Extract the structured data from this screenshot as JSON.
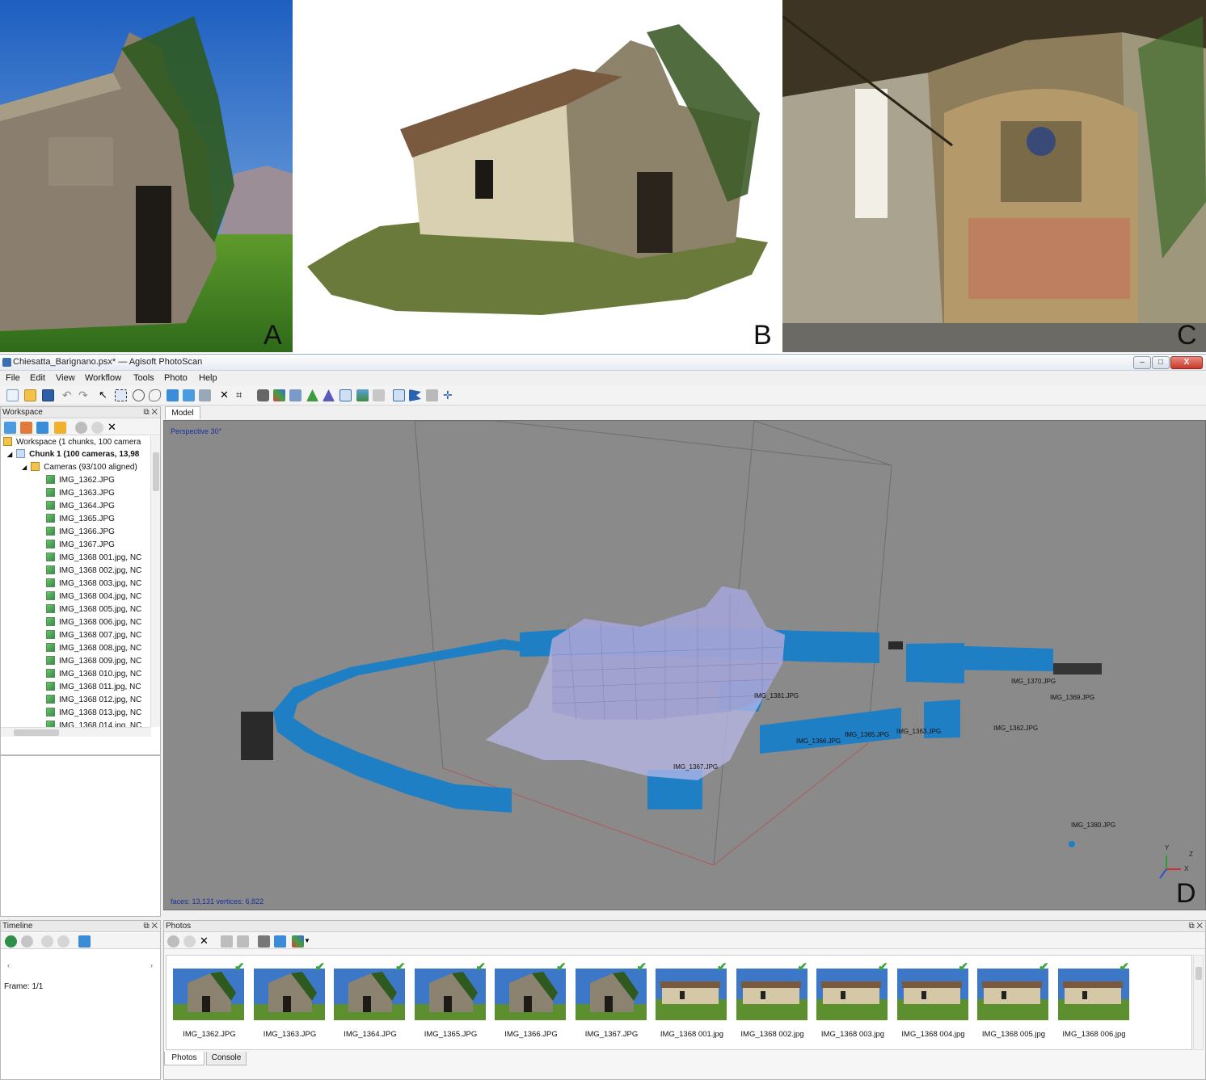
{
  "panels": {
    "a": {
      "letter": "A"
    },
    "b": {
      "letter": "B"
    },
    "c": {
      "letter": "C"
    },
    "d": {
      "letter": "D"
    }
  },
  "window": {
    "title": "Chiesatta_Barignano.psx* — Agisoft PhotoScan",
    "controls": {
      "minimize": "–",
      "maximize": "□",
      "close": "X"
    }
  },
  "menu": [
    "File",
    "Edit",
    "View",
    "Workflow",
    "Tools",
    "Photo",
    "Help"
  ],
  "workspace": {
    "header": "Workspace",
    "root": "Workspace (1 chunks, 100 camera",
    "chunk": "Chunk 1 (100 cameras, 13,98",
    "cameras_folder": "Cameras (93/100 aligned)",
    "cameras": [
      "IMG_1362.JPG",
      "IMG_1363.JPG",
      "IMG_1364.JPG",
      "IMG_1365.JPG",
      "IMG_1366.JPG",
      "IMG_1367.JPG",
      "IMG_1368 001.jpg, NC",
      "IMG_1368 002.jpg, NC",
      "IMG_1368 003.jpg, NC",
      "IMG_1368 004.jpg, NC",
      "IMG_1368 005.jpg, NC",
      "IMG_1368 006.jpg, NC",
      "IMG_1368 007.jpg, NC",
      "IMG_1368 008.jpg, NC",
      "IMG_1368 009.jpg, NC",
      "IMG_1368 010.jpg, NC",
      "IMG_1368 011.jpg, NC",
      "IMG_1368 012.jpg, NC",
      "IMG_1368 013.jpg, NC",
      "IMG_1368 014.jpg, NC"
    ]
  },
  "model": {
    "tab": "Model",
    "view_label": "Perspective 30°",
    "stats": "faces: 13,131 vertices: 6,822",
    "camera_labels": [
      {
        "text": "IMG_1370.JPG"
      },
      {
        "text": "IMG_1369.JPG"
      },
      {
        "text": "IMG_1381.JPG"
      },
      {
        "text": "IMG_1362.JPG"
      },
      {
        "text": "IMG_1366.JPG"
      },
      {
        "text": "IMG_1365.JPG"
      },
      {
        "text": "IMG_1363.JPG"
      },
      {
        "text": "IMG_1367.JPG"
      },
      {
        "text": "IMG_1380.JPG"
      }
    ],
    "axes": {
      "x": "X",
      "y": "Y",
      "z": "Z"
    },
    "colors": {
      "viewport": "#8a8a8a",
      "camera_planes": "#1f7fc4",
      "mesh": "#b8b8e8"
    }
  },
  "timeline": {
    "header": "Timeline",
    "frame": "Frame: 1/1"
  },
  "photos": {
    "header": "Photos",
    "items": [
      {
        "label": "IMG_1362.JPG",
        "check": "✔"
      },
      {
        "label": "IMG_1363.JPG",
        "check": "✔"
      },
      {
        "label": "IMG_1364.JPG",
        "check": "✔"
      },
      {
        "label": "IMG_1365.JPG",
        "check": "✔"
      },
      {
        "label": "IMG_1366.JPG",
        "check": "✔"
      },
      {
        "label": "IMG_1367.JPG",
        "check": "✔"
      },
      {
        "label": "IMG_1368 001.jpg",
        "check": "✔"
      },
      {
        "label": "IMG_1368 002.jpg",
        "check": "✔"
      },
      {
        "label": "IMG_1368 003.jpg",
        "check": "✔"
      },
      {
        "label": "IMG_1368 004.jpg",
        "check": "✔"
      },
      {
        "label": "IMG_1368 005.jpg",
        "check": "✔"
      },
      {
        "label": "IMG_1368 006.jpg",
        "check": "✔"
      }
    ],
    "tabs": {
      "photos": "Photos",
      "console": "Console"
    }
  }
}
